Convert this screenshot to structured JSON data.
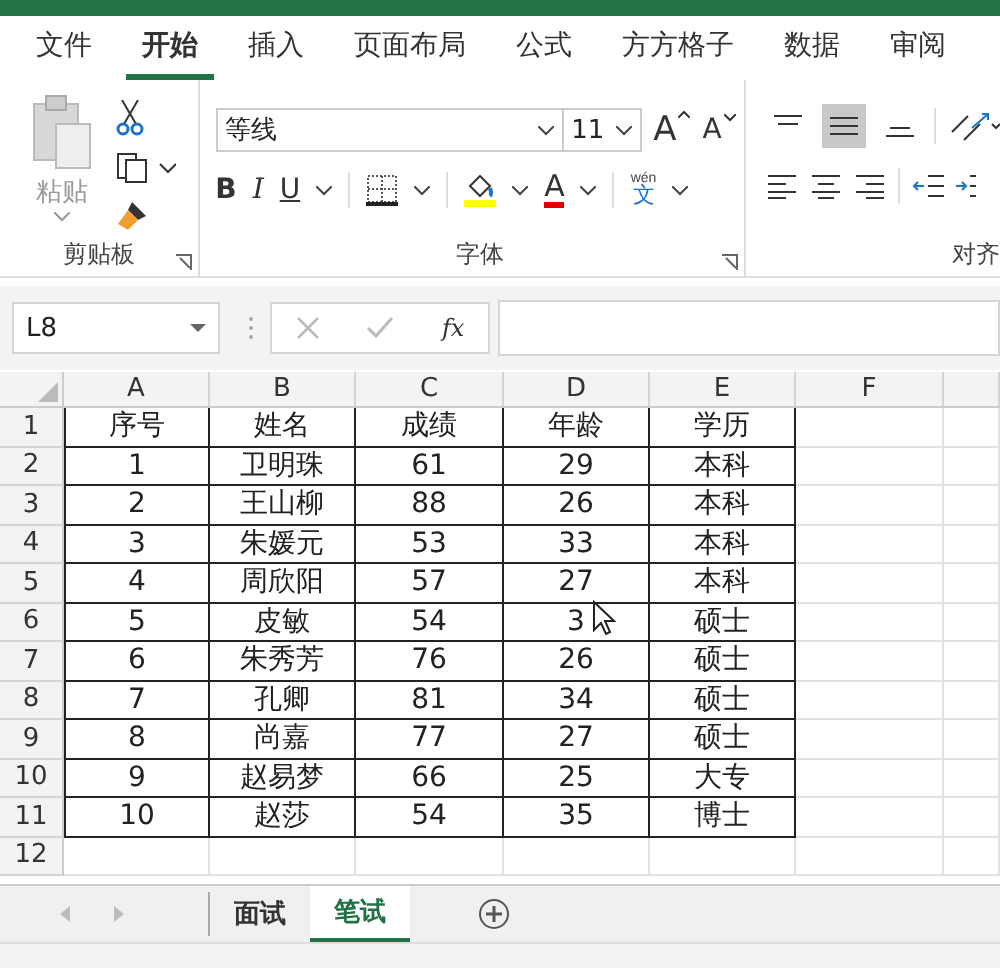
{
  "ribbon_tabs": [
    {
      "label": "文件",
      "selected": false
    },
    {
      "label": "开始",
      "selected": true
    },
    {
      "label": "插入",
      "selected": false
    },
    {
      "label": "页面布局",
      "selected": false
    },
    {
      "label": "公式",
      "selected": false
    },
    {
      "label": "方方格子",
      "selected": false
    },
    {
      "label": "数据",
      "selected": false
    },
    {
      "label": "审阅",
      "selected": false
    }
  ],
  "clipboard": {
    "paste_label": "粘贴",
    "group_label": "剪贴板"
  },
  "font": {
    "name": "等线",
    "size": "11",
    "grow": "A",
    "shrink": "A",
    "bold": "B",
    "italic": "I",
    "underline": "U",
    "color_letter": "A",
    "phonetic_top": "wén",
    "phonetic_char": "文",
    "group_label": "字体"
  },
  "alignment": {
    "group_label": "对齐",
    "top_buttons": [
      {
        "selected": false
      },
      {
        "selected": true
      },
      {
        "selected": false
      }
    ]
  },
  "formula_bar": {
    "name_box": "L8",
    "fx": "fx"
  },
  "sheet": {
    "columns": [
      "A",
      "B",
      "C",
      "D",
      "E",
      "F"
    ],
    "rows": [
      {
        "number": "1",
        "cells": [
          "序号",
          "姓名",
          "成绩",
          "年龄",
          "学历"
        ]
      },
      {
        "number": "2",
        "cells": [
          "1",
          "卫明珠",
          "61",
          "29",
          "本科"
        ]
      },
      {
        "number": "3",
        "cells": [
          "2",
          "王山柳",
          "88",
          "26",
          "本科"
        ]
      },
      {
        "number": "4",
        "cells": [
          "3",
          "朱媛元",
          "53",
          "33",
          "本科"
        ]
      },
      {
        "number": "5",
        "cells": [
          "4",
          "周欣阳",
          "57",
          "27",
          "本科"
        ]
      },
      {
        "number": "6",
        "cells": [
          "5",
          "皮敏",
          "54",
          "3",
          "硕士"
        ]
      },
      {
        "number": "7",
        "cells": [
          "6",
          "朱秀芳",
          "76",
          "26",
          "硕士"
        ]
      },
      {
        "number": "8",
        "cells": [
          "7",
          "孔卿",
          "81",
          "34",
          "硕士"
        ]
      },
      {
        "number": "9",
        "cells": [
          "8",
          "尚嘉",
          "77",
          "27",
          "硕士"
        ]
      },
      {
        "number": "10",
        "cells": [
          "9",
          "赵易梦",
          "66",
          "25",
          "大专"
        ]
      },
      {
        "number": "11",
        "cells": [
          "10",
          "赵莎",
          "54",
          "35",
          "博士"
        ]
      },
      {
        "number": "12",
        "cells": []
      }
    ]
  },
  "sheet_tabs": [
    {
      "label": "面试",
      "selected": false
    },
    {
      "label": "笔试",
      "selected": true
    }
  ]
}
